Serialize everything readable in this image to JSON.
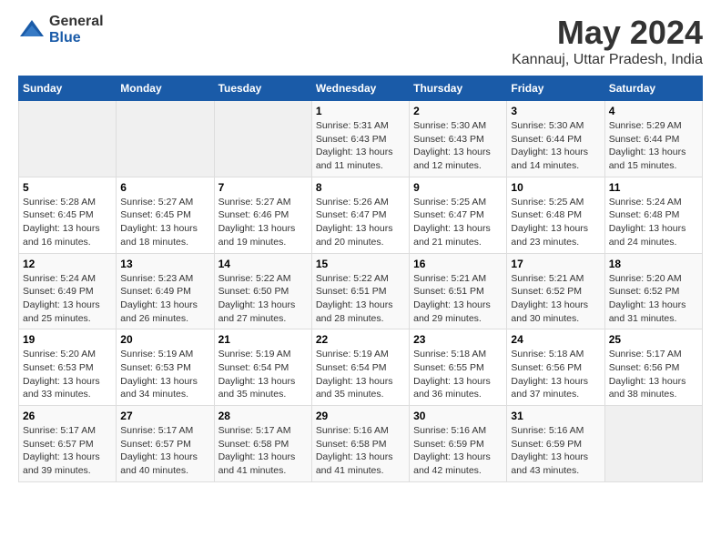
{
  "logo": {
    "general": "General",
    "blue": "Blue"
  },
  "title": "May 2024",
  "subtitle": "Kannauj, Uttar Pradesh, India",
  "days_of_week": [
    "Sunday",
    "Monday",
    "Tuesday",
    "Wednesday",
    "Thursday",
    "Friday",
    "Saturday"
  ],
  "weeks": [
    [
      {
        "day": "",
        "info": ""
      },
      {
        "day": "",
        "info": ""
      },
      {
        "day": "",
        "info": ""
      },
      {
        "day": "1",
        "info": "Sunrise: 5:31 AM\nSunset: 6:43 PM\nDaylight: 13 hours\nand 11 minutes."
      },
      {
        "day": "2",
        "info": "Sunrise: 5:30 AM\nSunset: 6:43 PM\nDaylight: 13 hours\nand 12 minutes."
      },
      {
        "day": "3",
        "info": "Sunrise: 5:30 AM\nSunset: 6:44 PM\nDaylight: 13 hours\nand 14 minutes."
      },
      {
        "day": "4",
        "info": "Sunrise: 5:29 AM\nSunset: 6:44 PM\nDaylight: 13 hours\nand 15 minutes."
      }
    ],
    [
      {
        "day": "5",
        "info": "Sunrise: 5:28 AM\nSunset: 6:45 PM\nDaylight: 13 hours\nand 16 minutes."
      },
      {
        "day": "6",
        "info": "Sunrise: 5:27 AM\nSunset: 6:45 PM\nDaylight: 13 hours\nand 18 minutes."
      },
      {
        "day": "7",
        "info": "Sunrise: 5:27 AM\nSunset: 6:46 PM\nDaylight: 13 hours\nand 19 minutes."
      },
      {
        "day": "8",
        "info": "Sunrise: 5:26 AM\nSunset: 6:47 PM\nDaylight: 13 hours\nand 20 minutes."
      },
      {
        "day": "9",
        "info": "Sunrise: 5:25 AM\nSunset: 6:47 PM\nDaylight: 13 hours\nand 21 minutes."
      },
      {
        "day": "10",
        "info": "Sunrise: 5:25 AM\nSunset: 6:48 PM\nDaylight: 13 hours\nand 23 minutes."
      },
      {
        "day": "11",
        "info": "Sunrise: 5:24 AM\nSunset: 6:48 PM\nDaylight: 13 hours\nand 24 minutes."
      }
    ],
    [
      {
        "day": "12",
        "info": "Sunrise: 5:24 AM\nSunset: 6:49 PM\nDaylight: 13 hours\nand 25 minutes."
      },
      {
        "day": "13",
        "info": "Sunrise: 5:23 AM\nSunset: 6:49 PM\nDaylight: 13 hours\nand 26 minutes."
      },
      {
        "day": "14",
        "info": "Sunrise: 5:22 AM\nSunset: 6:50 PM\nDaylight: 13 hours\nand 27 minutes."
      },
      {
        "day": "15",
        "info": "Sunrise: 5:22 AM\nSunset: 6:51 PM\nDaylight: 13 hours\nand 28 minutes."
      },
      {
        "day": "16",
        "info": "Sunrise: 5:21 AM\nSunset: 6:51 PM\nDaylight: 13 hours\nand 29 minutes."
      },
      {
        "day": "17",
        "info": "Sunrise: 5:21 AM\nSunset: 6:52 PM\nDaylight: 13 hours\nand 30 minutes."
      },
      {
        "day": "18",
        "info": "Sunrise: 5:20 AM\nSunset: 6:52 PM\nDaylight: 13 hours\nand 31 minutes."
      }
    ],
    [
      {
        "day": "19",
        "info": "Sunrise: 5:20 AM\nSunset: 6:53 PM\nDaylight: 13 hours\nand 33 minutes."
      },
      {
        "day": "20",
        "info": "Sunrise: 5:19 AM\nSunset: 6:53 PM\nDaylight: 13 hours\nand 34 minutes."
      },
      {
        "day": "21",
        "info": "Sunrise: 5:19 AM\nSunset: 6:54 PM\nDaylight: 13 hours\nand 35 minutes."
      },
      {
        "day": "22",
        "info": "Sunrise: 5:19 AM\nSunset: 6:54 PM\nDaylight: 13 hours\nand 35 minutes."
      },
      {
        "day": "23",
        "info": "Sunrise: 5:18 AM\nSunset: 6:55 PM\nDaylight: 13 hours\nand 36 minutes."
      },
      {
        "day": "24",
        "info": "Sunrise: 5:18 AM\nSunset: 6:56 PM\nDaylight: 13 hours\nand 37 minutes."
      },
      {
        "day": "25",
        "info": "Sunrise: 5:17 AM\nSunset: 6:56 PM\nDaylight: 13 hours\nand 38 minutes."
      }
    ],
    [
      {
        "day": "26",
        "info": "Sunrise: 5:17 AM\nSunset: 6:57 PM\nDaylight: 13 hours\nand 39 minutes."
      },
      {
        "day": "27",
        "info": "Sunrise: 5:17 AM\nSunset: 6:57 PM\nDaylight: 13 hours\nand 40 minutes."
      },
      {
        "day": "28",
        "info": "Sunrise: 5:17 AM\nSunset: 6:58 PM\nDaylight: 13 hours\nand 41 minutes."
      },
      {
        "day": "29",
        "info": "Sunrise: 5:16 AM\nSunset: 6:58 PM\nDaylight: 13 hours\nand 41 minutes."
      },
      {
        "day": "30",
        "info": "Sunrise: 5:16 AM\nSunset: 6:59 PM\nDaylight: 13 hours\nand 42 minutes."
      },
      {
        "day": "31",
        "info": "Sunrise: 5:16 AM\nSunset: 6:59 PM\nDaylight: 13 hours\nand 43 minutes."
      },
      {
        "day": "",
        "info": ""
      }
    ]
  ]
}
